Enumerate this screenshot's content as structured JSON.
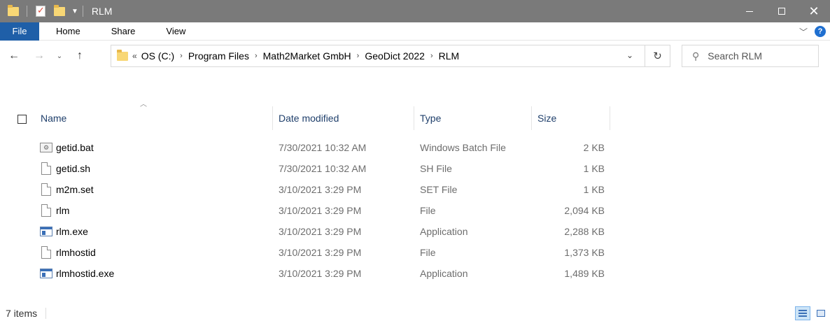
{
  "window": {
    "title": "RLM"
  },
  "ribbon": {
    "file_tab": "File",
    "tabs": [
      "Home",
      "Share",
      "View"
    ],
    "help": "?"
  },
  "nav": {
    "back_icon": "arrow-left-icon",
    "forward_icon": "arrow-right-icon",
    "recent_icon": "chevron-down-icon",
    "up_icon": "arrow-up-icon",
    "overflow": "«",
    "breadcrumbs": [
      "OS (C:)",
      "Program Files",
      "Math2Market GmbH",
      "GeoDict 2022",
      "RLM"
    ]
  },
  "search": {
    "placeholder": "Search RLM"
  },
  "columns": {
    "name": "Name",
    "date": "Date modified",
    "type": "Type",
    "size": "Size"
  },
  "files": [
    {
      "name": "getid.bat",
      "date": "7/30/2021 10:32 AM",
      "type": "Windows Batch File",
      "size": "2 KB",
      "icon": "bat"
    },
    {
      "name": "getid.sh",
      "date": "7/30/2021 10:32 AM",
      "type": "SH File",
      "size": "1 KB",
      "icon": "file"
    },
    {
      "name": "m2m.set",
      "date": "3/10/2021 3:29 PM",
      "type": "SET File",
      "size": "1 KB",
      "icon": "file"
    },
    {
      "name": "rlm",
      "date": "3/10/2021 3:29 PM",
      "type": "File",
      "size": "2,094 KB",
      "icon": "file"
    },
    {
      "name": "rlm.exe",
      "date": "3/10/2021 3:29 PM",
      "type": "Application",
      "size": "2,288 KB",
      "icon": "exe"
    },
    {
      "name": "rlmhostid",
      "date": "3/10/2021 3:29 PM",
      "type": "File",
      "size": "1,373 KB",
      "icon": "file"
    },
    {
      "name": "rlmhostid.exe",
      "date": "3/10/2021 3:29 PM",
      "type": "Application",
      "size": "1,489 KB",
      "icon": "exe"
    }
  ],
  "status": {
    "item_count": "7 items"
  },
  "colors": {
    "titlebar": "#7a7a7a",
    "file_tab": "#1f5fa8",
    "header_text": "#1f3f6b",
    "secondary_text": "#6d6d6d"
  }
}
